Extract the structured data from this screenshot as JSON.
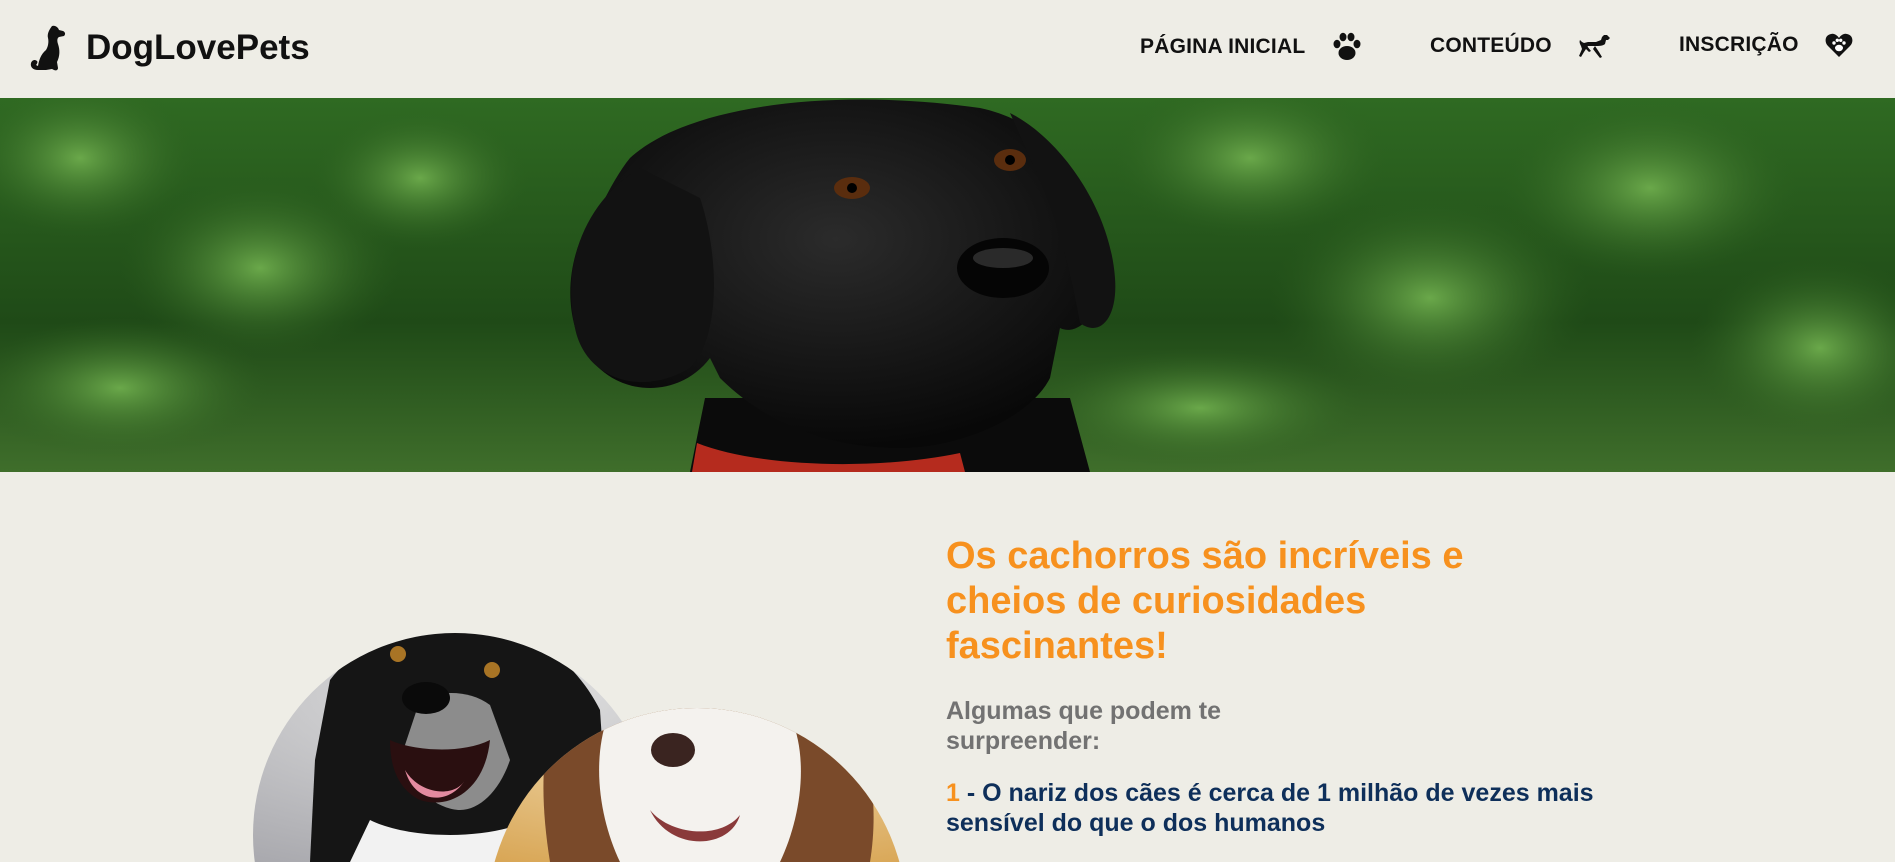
{
  "header": {
    "brand": "DogLovePets",
    "logo_icon": "sitting-dog-icon",
    "nav": [
      {
        "label": "PÁGINA INICIAL",
        "icon": "paw-icon"
      },
      {
        "label": "CONTEÚDO",
        "icon": "running-dog-icon"
      },
      {
        "label": "INSCRIÇÃO",
        "icon": "heart-paw-icon"
      }
    ]
  },
  "hero": {
    "image": "black-labrador-in-forest"
  },
  "intro": {
    "images": [
      "border-collie-portrait",
      "husky-portrait"
    ],
    "headline": "Os cachorros são incríveis e cheios de curiosidades fascinantes!",
    "subhead": "Algumas que podem te surpreender:",
    "facts": [
      {
        "number": "1",
        "text": " - O nariz dos cães é cerca de 1 milhão de vezes mais sensível do que o dos humanos"
      }
    ]
  },
  "colors": {
    "background": "#eeede6",
    "accent": "#f7911e",
    "heading_dark": "#0e2f5a",
    "muted": "#727272"
  }
}
